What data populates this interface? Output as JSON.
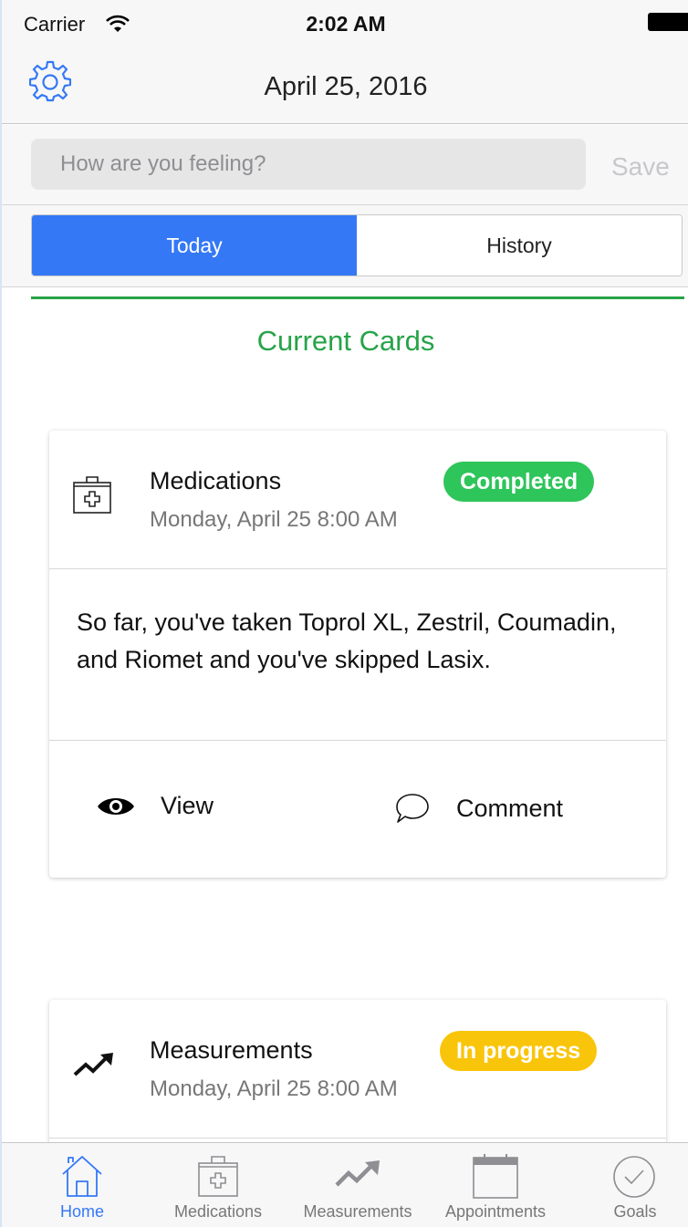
{
  "status_bar": {
    "carrier": "Carrier",
    "time": "2:02 AM"
  },
  "nav": {
    "title": "April 25, 2016",
    "settings_icon": "gear-icon"
  },
  "feeling": {
    "placeholder": "How are you feeling?",
    "save_label": "Save"
  },
  "segments": {
    "today": "Today",
    "history": "History",
    "selected": "Today"
  },
  "section_title": "Current Cards",
  "cards": [
    {
      "icon": "medkit-icon",
      "title": "Medications",
      "subtitle": "Monday, April 25 8:00 AM",
      "status": "Completed",
      "body": "So far, you've taken Toprol XL, Zestril, Coumadin, and Riomet and you've skipped Lasix.",
      "actions": {
        "view": "View",
        "comment": "Comment"
      }
    },
    {
      "icon": "trend-icon",
      "title": "Measurements",
      "subtitle": "Monday, April 25 8:00 AM",
      "status": "In progress"
    }
  ],
  "tabs": [
    {
      "label": "Home",
      "icon": "home-icon",
      "active": true
    },
    {
      "label": "Medications",
      "icon": "medkit-icon",
      "active": false
    },
    {
      "label": "Measurements",
      "icon": "trend-icon",
      "active": false
    },
    {
      "label": "Appointments",
      "icon": "calendar-icon",
      "active": false
    },
    {
      "label": "Goals",
      "icon": "checkmark-circle-icon",
      "active": false
    }
  ],
  "colors": {
    "accent_blue": "#3478f6",
    "section_green": "#27a348",
    "completed_green": "#2ec55a",
    "in_progress_yellow": "#f9c50b"
  }
}
